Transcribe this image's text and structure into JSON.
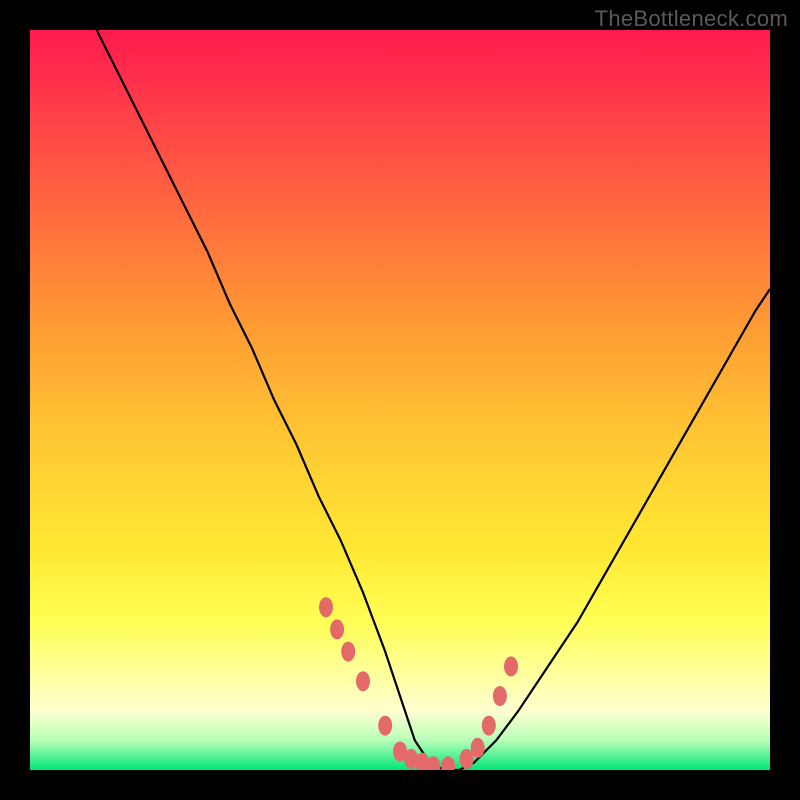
{
  "watermark": "TheBottleneck.com",
  "chart_data": {
    "type": "line",
    "title": "",
    "xlabel": "",
    "ylabel": "",
    "xlim": [
      0,
      100
    ],
    "ylim": [
      0,
      100
    ],
    "series": [
      {
        "name": "bottleneck-curve",
        "x": [
          9,
          12,
          15,
          18,
          21,
          24,
          27,
          30,
          33,
          36,
          39,
          42,
          45,
          48,
          50,
          52,
          54,
          56,
          58,
          60,
          63,
          66,
          70,
          74,
          78,
          82,
          86,
          90,
          94,
          98,
          100
        ],
        "y": [
          100,
          94,
          88,
          82,
          76,
          70,
          63,
          57,
          50,
          44,
          37,
          31,
          24,
          16,
          10,
          4,
          1,
          0,
          0,
          1,
          4,
          8,
          14,
          20,
          27,
          34,
          41,
          48,
          55,
          62,
          65
        ]
      }
    ],
    "markers": {
      "name": "highlight-dots",
      "color": "#e46a6a",
      "x": [
        40,
        41.5,
        43,
        45,
        48,
        50,
        51.5,
        53,
        54.5,
        56.5,
        59,
        60.5,
        62,
        63.5,
        65
      ],
      "y": [
        22,
        19,
        16,
        12,
        6,
        2.5,
        1.5,
        1,
        0.5,
        0.5,
        1.5,
        3,
        6,
        10,
        14
      ]
    },
    "background_gradient": {
      "top": "#ff1a4d",
      "upper_mid": "#ffb833",
      "lower_mid": "#ffff66",
      "bottom": "#00e676"
    }
  }
}
